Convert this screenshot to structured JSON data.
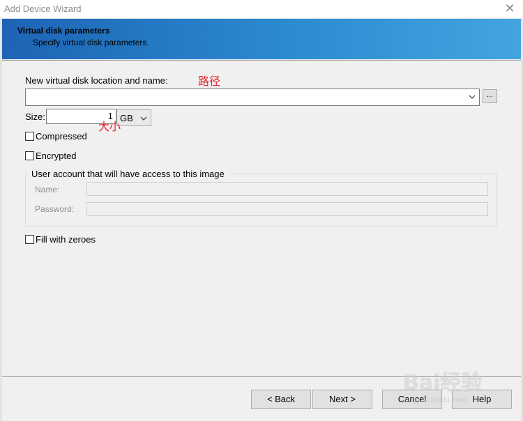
{
  "window": {
    "title": "Add Device Wizard",
    "close_glyph": "✕"
  },
  "header": {
    "title": "Virtual disk parameters",
    "subtitle": "Specify virtual disk parameters."
  },
  "location": {
    "label": "New virtual disk location and name:",
    "annotation": "路径",
    "value": "",
    "browse_label": "..."
  },
  "size": {
    "label": "Size:",
    "value": "1",
    "unit": "GB",
    "annotation": "大小"
  },
  "options": {
    "compressed": {
      "label": "Compressed",
      "checked": false
    },
    "encrypted": {
      "label": "Encrypted",
      "checked": false
    },
    "fill_zeroes": {
      "label": "Fill with zeroes",
      "checked": false
    }
  },
  "user_account": {
    "legend": "User account that will have access to this image",
    "name_label": "Name:",
    "password_label": "Password:"
  },
  "buttons": {
    "back": "< Back",
    "next": "Next >",
    "cancel": "Cancel",
    "help": "Help"
  },
  "watermark": {
    "text": "Bai经验",
    "url": "jingyan.baidu.com"
  },
  "colors": {
    "banner_start": "#1d64b4",
    "banner_end": "#44a4df",
    "annotation": "#e8232a"
  }
}
